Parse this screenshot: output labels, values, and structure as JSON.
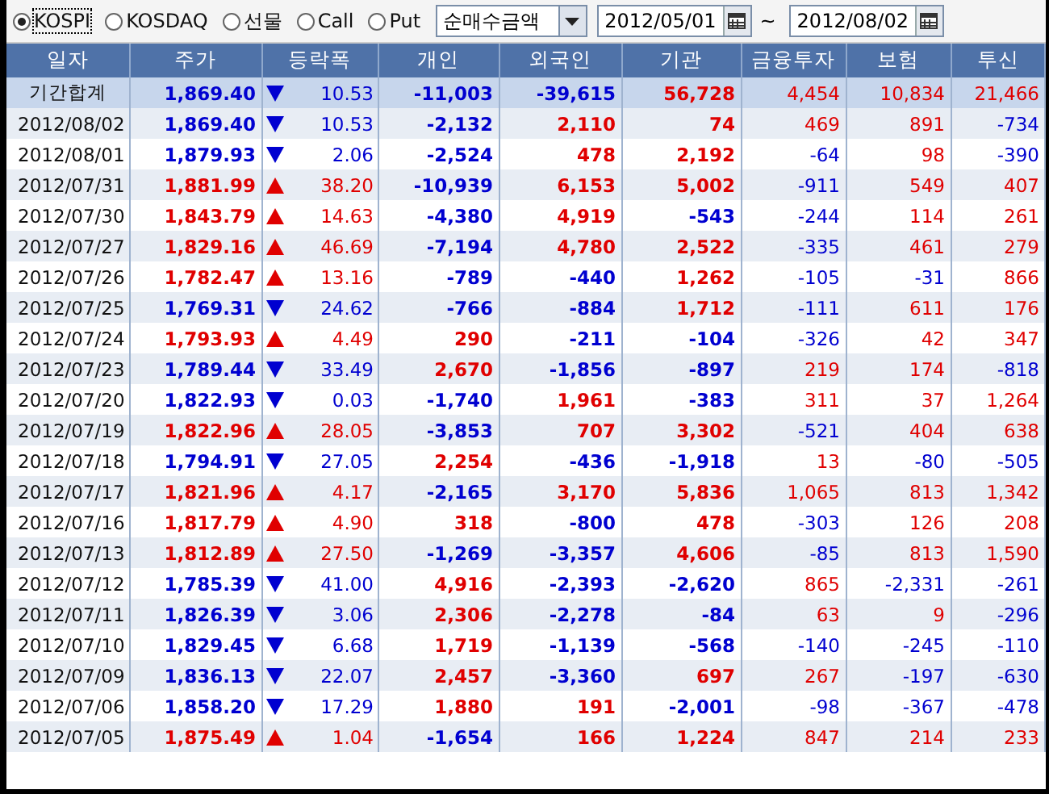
{
  "markets": [
    {
      "label": "KOSPI",
      "selected": true
    },
    {
      "label": "KOSDAQ",
      "selected": false
    },
    {
      "label": "선물",
      "selected": false
    },
    {
      "label": "Call",
      "selected": false
    },
    {
      "label": "Put",
      "selected": false
    }
  ],
  "metric": {
    "value": "순매수금액"
  },
  "date_from": {
    "value": "2012/05/01"
  },
  "range_sep": "~",
  "date_to": {
    "value": "2012/08/02"
  },
  "table": {
    "columns": [
      "일자",
      "주가",
      "등락폭",
      "개인",
      "외국인",
      "기관",
      "금융투자",
      "보험",
      "투신"
    ],
    "rows": [
      {
        "kind": "total",
        "rising": false,
        "cells": [
          "기간합계",
          "1,869.40",
          "10.53",
          "-11,003",
          "-39,615",
          "56,728",
          "4,454",
          "10,834",
          "21,466"
        ]
      },
      {
        "kind": "day",
        "rising": false,
        "cells": [
          "2012/08/02",
          "1,869.40",
          "10.53",
          "-2,132",
          "2,110",
          "74",
          "469",
          "891",
          "-734"
        ]
      },
      {
        "kind": "day",
        "rising": false,
        "cells": [
          "2012/08/01",
          "1,879.93",
          "2.06",
          "-2,524",
          "478",
          "2,192",
          "-64",
          "98",
          "-390"
        ]
      },
      {
        "kind": "day",
        "rising": true,
        "cells": [
          "2012/07/31",
          "1,881.99",
          "38.20",
          "-10,939",
          "6,153",
          "5,002",
          "-911",
          "549",
          "407"
        ]
      },
      {
        "kind": "day",
        "rising": true,
        "cells": [
          "2012/07/30",
          "1,843.79",
          "14.63",
          "-4,380",
          "4,919",
          "-543",
          "-244",
          "114",
          "261"
        ]
      },
      {
        "kind": "day",
        "rising": true,
        "cells": [
          "2012/07/27",
          "1,829.16",
          "46.69",
          "-7,194",
          "4,780",
          "2,522",
          "-335",
          "461",
          "279"
        ]
      },
      {
        "kind": "day",
        "rising": true,
        "cells": [
          "2012/07/26",
          "1,782.47",
          "13.16",
          "-789",
          "-440",
          "1,262",
          "-105",
          "-31",
          "866"
        ]
      },
      {
        "kind": "day",
        "rising": false,
        "cells": [
          "2012/07/25",
          "1,769.31",
          "24.62",
          "-766",
          "-884",
          "1,712",
          "-111",
          "611",
          "176"
        ]
      },
      {
        "kind": "day",
        "rising": true,
        "cells": [
          "2012/07/24",
          "1,793.93",
          "4.49",
          "290",
          "-211",
          "-104",
          "-326",
          "42",
          "347"
        ]
      },
      {
        "kind": "day",
        "rising": false,
        "cells": [
          "2012/07/23",
          "1,789.44",
          "33.49",
          "2,670",
          "-1,856",
          "-897",
          "219",
          "174",
          "-818"
        ]
      },
      {
        "kind": "day",
        "rising": false,
        "cells": [
          "2012/07/20",
          "1,822.93",
          "0.03",
          "-1,740",
          "1,961",
          "-383",
          "311",
          "37",
          "1,264"
        ]
      },
      {
        "kind": "day",
        "rising": true,
        "cells": [
          "2012/07/19",
          "1,822.96",
          "28.05",
          "-3,853",
          "707",
          "3,302",
          "-521",
          "404",
          "638"
        ]
      },
      {
        "kind": "day",
        "rising": false,
        "cells": [
          "2012/07/18",
          "1,794.91",
          "27.05",
          "2,254",
          "-436",
          "-1,918",
          "13",
          "-80",
          "-505"
        ]
      },
      {
        "kind": "day",
        "rising": true,
        "cells": [
          "2012/07/17",
          "1,821.96",
          "4.17",
          "-2,165",
          "3,170",
          "5,836",
          "1,065",
          "813",
          "1,342"
        ]
      },
      {
        "kind": "day",
        "rising": true,
        "cells": [
          "2012/07/16",
          "1,817.79",
          "4.90",
          "318",
          "-800",
          "478",
          "-303",
          "126",
          "208"
        ]
      },
      {
        "kind": "day",
        "rising": true,
        "cells": [
          "2012/07/13",
          "1,812.89",
          "27.50",
          "-1,269",
          "-3,357",
          "4,606",
          "-85",
          "813",
          "1,590"
        ]
      },
      {
        "kind": "day",
        "rising": false,
        "cells": [
          "2012/07/12",
          "1,785.39",
          "41.00",
          "4,916",
          "-2,393",
          "-2,620",
          "865",
          "-2,331",
          "-261"
        ]
      },
      {
        "kind": "day",
        "rising": false,
        "cells": [
          "2012/07/11",
          "1,826.39",
          "3.06",
          "2,306",
          "-2,278",
          "-84",
          "63",
          "9",
          "-296"
        ]
      },
      {
        "kind": "day",
        "rising": false,
        "cells": [
          "2012/07/10",
          "1,829.45",
          "6.68",
          "1,719",
          "-1,139",
          "-568",
          "-140",
          "-245",
          "-110"
        ]
      },
      {
        "kind": "day",
        "rising": false,
        "cells": [
          "2012/07/09",
          "1,836.13",
          "22.07",
          "2,457",
          "-3,360",
          "697",
          "267",
          "-197",
          "-630"
        ]
      },
      {
        "kind": "day",
        "rising": false,
        "cells": [
          "2012/07/06",
          "1,858.20",
          "17.29",
          "1,880",
          "191",
          "-2,001",
          "-98",
          "-367",
          "-478"
        ]
      },
      {
        "kind": "day",
        "rising": true,
        "cells": [
          "2012/07/05",
          "1,875.49",
          "1.04",
          "-1,654",
          "166",
          "1,224",
          "847",
          "214",
          "233"
        ]
      }
    ]
  }
}
